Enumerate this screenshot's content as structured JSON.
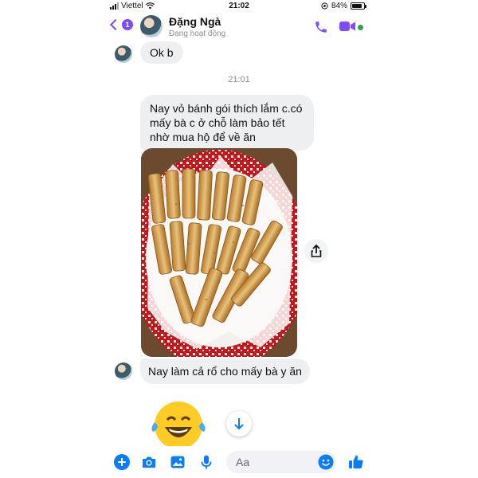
{
  "status_bar": {
    "carrier": "Viettel",
    "time": "21:02",
    "battery": "84%",
    "battery_level": 0.84
  },
  "header": {
    "name": "Đặng Ngà",
    "status": "Đang hoạt động",
    "unread_count": "1"
  },
  "messages": {
    "ok": "Ok b",
    "timestamp": "21:01",
    "long": "Nay vỏ bánh gói thích lắm c.có mấy bà c ở chỗ làm bảo tết nhờ mua hộ để về ăn",
    "last": "Nay làm cả rổ cho mấy bà y ăn"
  },
  "composer": {
    "placeholder": "Aa"
  },
  "colors": {
    "accent": "#7b4dff",
    "messenger_blue": "#0a7cff",
    "bubble_gray": "#eeeff1",
    "online_green": "#31a24c"
  },
  "icons": [
    "back-chevron-icon",
    "phone-call-icon",
    "video-call-icon",
    "share-icon",
    "arrow-down-icon",
    "plus-icon",
    "camera-icon",
    "photo-icon",
    "microphone-icon",
    "smile-icon",
    "like-icon",
    "laughing-emoji-icon"
  ]
}
